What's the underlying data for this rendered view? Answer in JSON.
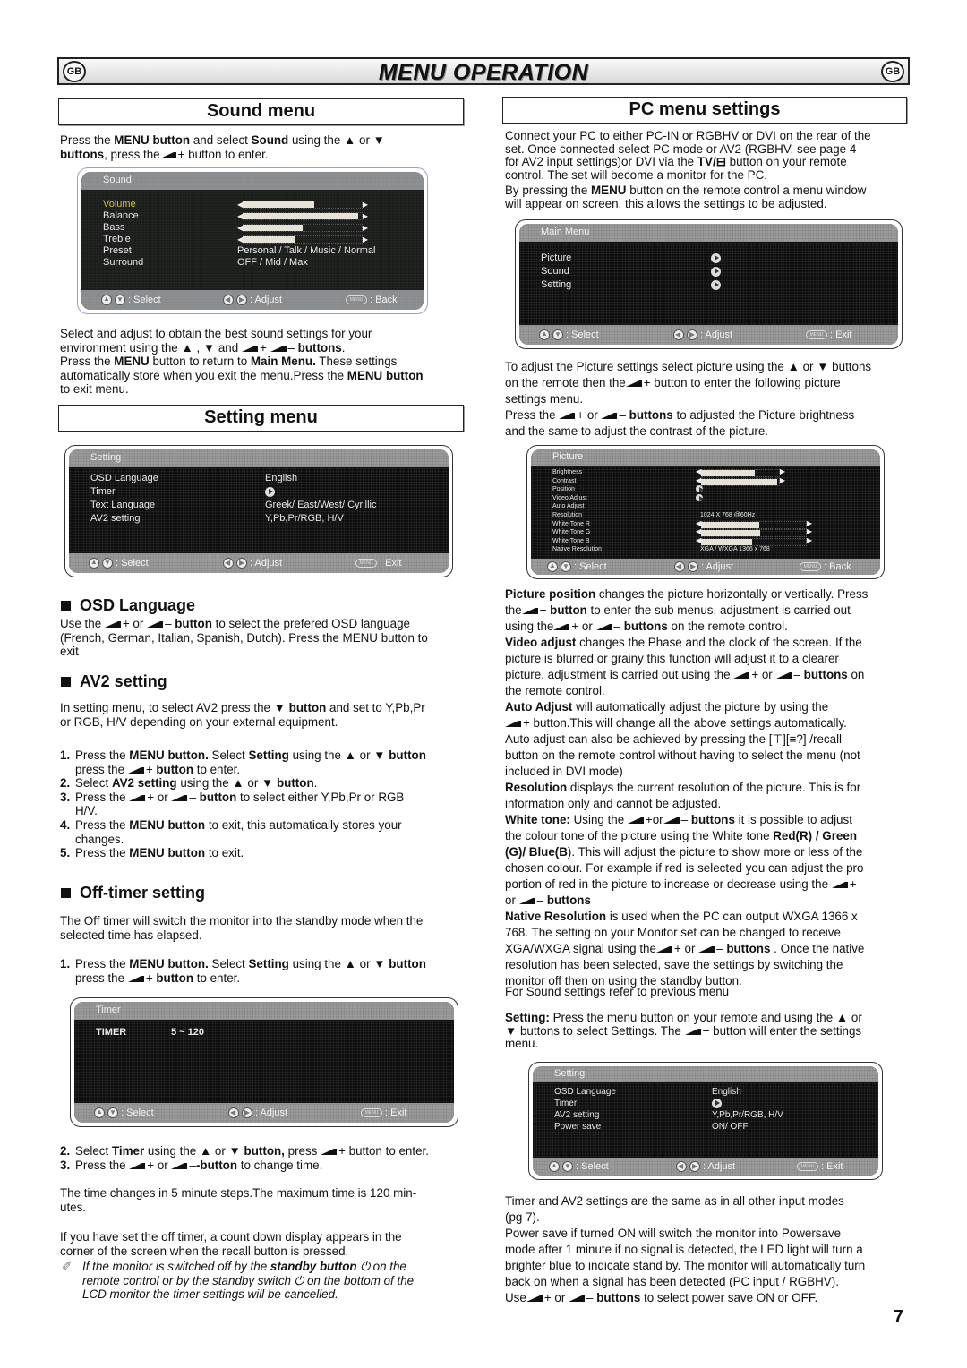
{
  "header": {
    "badge_left": "GB",
    "title": "MENU OPERATION",
    "badge_right": "GB"
  },
  "sound_section": {
    "heading": "Sound menu",
    "intro": [
      {
        "t": "Press the "
      },
      {
        "b": "MENU button"
      },
      {
        "t": " and select "
      },
      {
        "b": "Sound"
      },
      {
        "t": " using the ▲ or ▼ "
      },
      {
        "br": true
      },
      {
        "b": "buttons"
      },
      {
        "t": ", press the"
      },
      {
        "icon": "vol-up"
      },
      {
        "t": "  button to enter."
      }
    ],
    "osd": {
      "title": "Sound",
      "items": [
        {
          "label": "Volume",
          "selected": true,
          "type": "slider",
          "level": 0.6
        },
        {
          "label": "Balance",
          "type": "slider",
          "level": 0.96
        },
        {
          "label": "Bass",
          "type": "slider",
          "level": 0.5
        },
        {
          "label": "Treble",
          "type": "slider",
          "level": 0.43
        },
        {
          "label": "Preset",
          "type": "text",
          "value": "Personal / Talk / Music / Normal"
        },
        {
          "label": "Surround",
          "type": "text",
          "value": "OFF / Mid / Max"
        }
      ],
      "footer": {
        "select": ": Select",
        "adjust": ": Adjust",
        "menu_key": "MENU",
        "back": ": Back"
      }
    },
    "after": [
      {
        "t": "Select and adjust to obtain the best sound settings for your "
      },
      {
        "br": true
      },
      {
        "t": "environment using the ▲ , ▼ and "
      },
      {
        "icon": "vol-up"
      },
      {
        "t": "  "
      },
      {
        "icon": "vol-down"
      },
      {
        "b": " buttons"
      },
      {
        "t": "."
      },
      {
        "br": true
      },
      {
        "t": "Press the "
      },
      {
        "b": "MENU"
      },
      {
        "t": " button to return to "
      },
      {
        "b": "Main Menu."
      },
      {
        "t": " These settings "
      },
      {
        "br": true
      },
      {
        "t": "automatically store when you exit the menu.Press the "
      },
      {
        "b": "MENU button"
      },
      {
        "br": true
      },
      {
        "t": "to exit menu."
      }
    ]
  },
  "setting_section": {
    "heading": "Setting menu",
    "osd": {
      "title": "Setting",
      "items": [
        {
          "label": "OSD Language",
          "value": "English"
        },
        {
          "label": "Timer",
          "value_icon": "arrow-right"
        },
        {
          "label": "Text Language",
          "value": "Greek/ East/West/ Cyrillic"
        },
        {
          "label": "AV2  setting",
          "value": "Y,Pb,Pr/RGB,  H/V"
        }
      ],
      "footer": {
        "select": ": Select",
        "adjust": ": Adjust",
        "menu_key": "MENU",
        "exit": ": Exit"
      }
    },
    "osd_language": {
      "heading": "OSD Language",
      "body": [
        {
          "t": "Use the "
        },
        {
          "icon": "vol-up"
        },
        {
          "t": "  or "
        },
        {
          "icon": "vol-down"
        },
        {
          "b": " button"
        },
        {
          "t": " to select the prefered OSD language "
        },
        {
          "br": true
        },
        {
          "t": "(French, German, Italian, Spanish, Dutch). Press the MENU button to "
        },
        {
          "br": true
        },
        {
          "t": "exit"
        }
      ]
    },
    "av2": {
      "heading": "AV2 setting",
      "body": [
        {
          "t": "In setting menu, to select AV2 press the ▼ "
        },
        {
          "b": "button"
        },
        {
          "t": " and set to Y,Pb,Pr "
        },
        {
          "br": true
        },
        {
          "t": "or RGB, H/V depending on your external equipment."
        }
      ],
      "steps": [
        [
          {
            "t": "Press the "
          },
          {
            "b": "MENU button."
          },
          {
            "t": " Select "
          },
          {
            "b": "Setting"
          },
          {
            "t": " using the ▲ or ▼ "
          },
          {
            "b": "button"
          },
          {
            "br": true
          },
          {
            "t": "press the "
          },
          {
            "icon": "vol-up"
          },
          {
            "b": " button"
          },
          {
            "t": " to enter."
          }
        ],
        [
          {
            "t": "Select "
          },
          {
            "b": "AV2 setting"
          },
          {
            "t": " using the ▲ or ▼ "
          },
          {
            "b": "button"
          },
          {
            "t": "."
          }
        ],
        [
          {
            "t": "Press the "
          },
          {
            "icon": "vol-up"
          },
          {
            "t": "  or "
          },
          {
            "icon": "vol-down"
          },
          {
            "b": " button"
          },
          {
            "t": " to select either Y,Pb,Pr or RGB "
          },
          {
            "br": true
          },
          {
            "t": "H/V."
          }
        ],
        [
          {
            "t": "Press the "
          },
          {
            "b": "MENU button"
          },
          {
            "t": " to exit, this automatically stores your "
          },
          {
            "br": true
          },
          {
            "t": "changes."
          }
        ],
        [
          {
            "t": "Press the "
          },
          {
            "b": "MENU button"
          },
          {
            "t": " to exit."
          }
        ]
      ]
    },
    "off_timer": {
      "heading": "Off-timer setting",
      "body": [
        {
          "t": "The Off timer will switch the monitor into the standby mode when the "
        },
        {
          "br": true
        },
        {
          "t": "selected time has elapsed."
        }
      ],
      "step1": [
        {
          "t": "Press the "
        },
        {
          "b": "MENU button."
        },
        {
          "t": " Select "
        },
        {
          "b": "Setting"
        },
        {
          "t": " using the ▲ or ▼ "
        },
        {
          "b": "button"
        },
        {
          "br": true
        },
        {
          "t": "press the "
        },
        {
          "icon": "vol-up"
        },
        {
          "b": " button"
        },
        {
          "t": " to enter."
        }
      ],
      "osd": {
        "title": "Timer",
        "label": "TIMER",
        "value": "5 ~ 120",
        "footer": {
          "select": ": Select",
          "adjust": ": Adjust",
          "menu_key": "MENU",
          "exit": ": Exit"
        }
      },
      "steps_after": [
        [
          {
            "t": "Select "
          },
          {
            "b": "Timer"
          },
          {
            "t": " using the ▲ or ▼ "
          },
          {
            "b": "button,"
          },
          {
            "t": " press "
          },
          {
            "icon": "vol-up"
          },
          {
            "t": "  button to enter."
          }
        ],
        [
          {
            "t": "Press the "
          },
          {
            "icon": "vol-up"
          },
          {
            "t": "  or "
          },
          {
            "icon": "vol-down"
          },
          {
            "b": "-button"
          },
          {
            "t": " to change time."
          }
        ]
      ],
      "time_note": "The time changes in 5 minute steps.The maximum time is 120 min-\nutes.",
      "countdown": "If you have set the off timer, a count down display appears in the\ncorner of the screen when the recall button is pressed.",
      "standby_note": [
        {
          "t": "If the monitor is switched off by the "
        },
        {
          "b": "standby button"
        },
        {
          "t": " ⏻ on the "
        },
        {
          "br": true
        },
        {
          "t": "remote control or by the standby switch ⏻ on the bottom of the "
        },
        {
          "br": true
        },
        {
          "t": "LCD monitor the timer settings will be cancelled."
        }
      ]
    }
  },
  "pc_section": {
    "heading": "PC menu settings",
    "intro": [
      {
        "t": "Connect your PC to either PC-IN or RGBHV or DVI on the rear of the "
      },
      {
        "br": true
      },
      {
        "t": "set. Once connected select PC mode or AV2  (RGBHV, see page 4 "
      },
      {
        "br": true
      },
      {
        "t": " for AV2 input settings)or DVI via the "
      },
      {
        "b": "TV/⊟"
      },
      {
        "t": "  button on your remote "
      },
      {
        "br": true
      },
      {
        "t": "control. The set will become a monitor for the PC."
      }
    ],
    "intro2": [
      {
        "t": "By pressing the "
      },
      {
        "b": "MENU"
      },
      {
        "t": " button on the remote control a menu window "
      },
      {
        "br": true
      },
      {
        "t": "will appear on screen, this allows the settings to be adjusted."
      }
    ],
    "main_menu_osd": {
      "title": "Main Menu",
      "items": [
        "Picture",
        "Sound",
        "Setting"
      ],
      "footer": {
        "select": ": Select",
        "adjust": ": Adjust",
        "menu_key": "MENU",
        "exit": ": Exit"
      }
    },
    "picture_intro": [
      {
        "t": "To adjust the Picture settings select picture using the ▲ or ▼  buttons "
      },
      {
        "br": true
      },
      {
        "t": "on the remote then the"
      },
      {
        "icon": "vol-up"
      },
      {
        "t": "  button to enter the following  picture "
      },
      {
        "br": true
      },
      {
        "t": "settings menu."
      },
      {
        "br": true
      },
      {
        "t": "Press the  "
      },
      {
        "icon": "vol-up"
      },
      {
        "t": "  or "
      },
      {
        "icon": "vol-down"
      },
      {
        "b": " buttons"
      },
      {
        "t": " to adjusted the Picture brightness "
      },
      {
        "br": true
      },
      {
        "t": "and the same to adjust the contrast of the picture."
      }
    ],
    "picture_osd": {
      "title": "Picture",
      "items": [
        {
          "label": "Brightness",
          "type": "slider",
          "level": 0.68
        },
        {
          "label": "Contrast",
          "type": "slider",
          "level": 0.97
        },
        {
          "label": "Position",
          "type": "arrow"
        },
        {
          "label": "Video Adjust",
          "type": "arrow"
        },
        {
          "label": "Auto Adjust",
          "type": "none"
        },
        {
          "label": "Resolution",
          "type": "text",
          "value": "1024  X  768       @60Hz"
        },
        {
          "label": "White Tone R",
          "type": "slider",
          "level": 0.55
        },
        {
          "label": "White Tone G",
          "type": "slider",
          "level": 0.56
        },
        {
          "label": "White Tone B",
          "type": "slider",
          "level": 0.48
        },
        {
          "label": "Native Resolution",
          "type": "text",
          "value": "XGA / WXGA 1366 x 768"
        }
      ],
      "footer": {
        "select": ": Select",
        "adjust": ": Adjust",
        "menu_key": "MENU",
        "back": ": Back"
      }
    },
    "descriptions": [
      [
        {
          "b": "Picture position"
        },
        {
          "t": " changes the picture horizontally or vertically.  Press "
        },
        {
          "br": true
        },
        {
          "t": "the"
        },
        {
          "icon": "vol-up"
        },
        {
          "b": "  button"
        },
        {
          "t": " to enter the sub menus, adjustment is carried out "
        },
        {
          "br": true
        },
        {
          "t": "using the"
        },
        {
          "icon": "vol-up"
        },
        {
          "t": "  or "
        },
        {
          "icon": "vol-down"
        },
        {
          "b": " buttons"
        },
        {
          "t": " on the remote control."
        }
      ],
      [
        {
          "b": "Video adjust"
        },
        {
          "t": " changes the Phase and the clock of the screen. If the "
        },
        {
          "br": true
        },
        {
          "t": "picture is blurred or grainy this function will adjust it to a clearer "
        },
        {
          "br": true
        },
        {
          "t": "picture, adjustment is carried out using the "
        },
        {
          "icon": "vol-up"
        },
        {
          "t": "  or "
        },
        {
          "icon": "vol-down"
        },
        {
          "b": " buttons"
        },
        {
          "t": " on "
        },
        {
          "br": true
        },
        {
          "t": "the remote control."
        }
      ],
      [
        {
          "b": "Auto Adjust"
        },
        {
          "t": " will automatically adjust the picture by using the "
        },
        {
          "br": true
        },
        {
          "icon": "vol-up"
        },
        {
          "t": "  button.This will change all the above settings automatically."
        },
        {
          "br": true
        },
        {
          "t": "Auto adjust can also be achieved by pressing the [⊤][≡?]    /recall "
        },
        {
          "br": true
        },
        {
          "t": "button on the remote control without having to select the menu (not "
        },
        {
          "br": true
        },
        {
          "t": "included in DVI mode)"
        }
      ],
      [
        {
          "b": "Resolution"
        },
        {
          "t": " displays the current resolution  of the picture. This is for "
        },
        {
          "br": true
        },
        {
          "t": "information only and cannot be adjusted."
        }
      ],
      [
        {
          "b": "White tone:"
        },
        {
          "t": " Using the "
        },
        {
          "icon": "vol-up"
        },
        {
          "t": "or"
        },
        {
          "icon": "vol-down"
        },
        {
          "b": " buttons"
        },
        {
          "t": " it is possible to adjust "
        },
        {
          "br": true
        },
        {
          "t": "the colour tone of the picture using the White tone "
        },
        {
          "b": "Red(R) / Green"
        },
        {
          "br": true
        },
        {
          "b": "(G)/ Blue(B"
        },
        {
          "t": "). This will adjust the picture to show more or less of the "
        },
        {
          "br": true
        },
        {
          "t": "chosen colour. For example if red is selected you can adjust the pro "
        },
        {
          "br": true
        },
        {
          "t": "portion of red in the picture to increase or decrease using the "
        },
        {
          "icon": "vol-up"
        },
        {
          "br": true
        },
        {
          "t": "or "
        },
        {
          "icon": "vol-down"
        },
        {
          "b": " buttons"
        }
      ],
      [
        {
          "b": "Native Resolution"
        },
        {
          "t": " is used when the PC can output WXGA 1366 x "
        },
        {
          "br": true
        },
        {
          "t": "768. The setting on your Monitor set can be changed to receive "
        },
        {
          "br": true
        },
        {
          "t": "XGA/WXGA signal using the"
        },
        {
          "icon": "vol-up"
        },
        {
          "t": "  or "
        },
        {
          "icon": "vol-down"
        },
        {
          "b": " buttons"
        },
        {
          "t": " . Once the native "
        },
        {
          "br": true
        },
        {
          "t": "resolution has been selected, save the settings by switching the "
        },
        {
          "br": true
        },
        {
          "t": "monitor off then on using the standby  button."
        }
      ]
    ],
    "sound_ref": "For Sound settings refer to previous menu",
    "setting_text": [
      {
        "b": "Setting:"
      },
      {
        "t": " Press the menu button on your remote and using the  ▲ or "
      },
      {
        "br": true
      },
      {
        "t": "▼  buttons to select Settings. The "
      },
      {
        "icon": "vol-up"
      },
      {
        "t": "  button will  enter the settings "
      },
      {
        "br": true
      },
      {
        "t": "menu."
      }
    ],
    "setting_osd": {
      "title": "Setting",
      "items": [
        {
          "label": "OSD Language",
          "value": "English"
        },
        {
          "label": "Timer",
          "value_icon": "arrow-right"
        },
        {
          "label": "AV2  setting",
          "value": "Y,Pb,Pr/RGB,  H/V"
        },
        {
          "label": "Power save",
          "value": "ON/ OFF"
        }
      ],
      "footer": {
        "select": ": Select",
        "adjust": ": Adjust",
        "menu_key": "MENU",
        "exit": ": Exit"
      }
    },
    "closing": [
      {
        "t": "Timer  and AV2 settings are the same as in all other input modes "
      },
      {
        "br": true
      },
      {
        "t": "(pg 7)."
      },
      {
        "br": true
      },
      {
        "t": "Power save if turned ON will switch the monitor into Powersave "
      },
      {
        "br": true
      },
      {
        "t": "mode after 1 minute if no signal is detected, the LED light will turn a "
      },
      {
        "br": true
      },
      {
        "t": "brighter blue to indicate stand by. The monitor will automatically turn "
      },
      {
        "br": true
      },
      {
        "t": "back on when a signal has been detected (PC input / RGBHV)."
      },
      {
        "br": true
      },
      {
        "t": "Use"
      },
      {
        "icon": "vol-up"
      },
      {
        "t": "  or  "
      },
      {
        "icon": "vol-down"
      },
      {
        "b": " buttons"
      },
      {
        "t": " to select power save ON or OFF."
      }
    ]
  },
  "page_number": "7",
  "colors": {
    "osd_selected": "#d8c23a",
    "osd_bg": "#0e0e0e",
    "osd_bar": "#9a9a9a"
  }
}
